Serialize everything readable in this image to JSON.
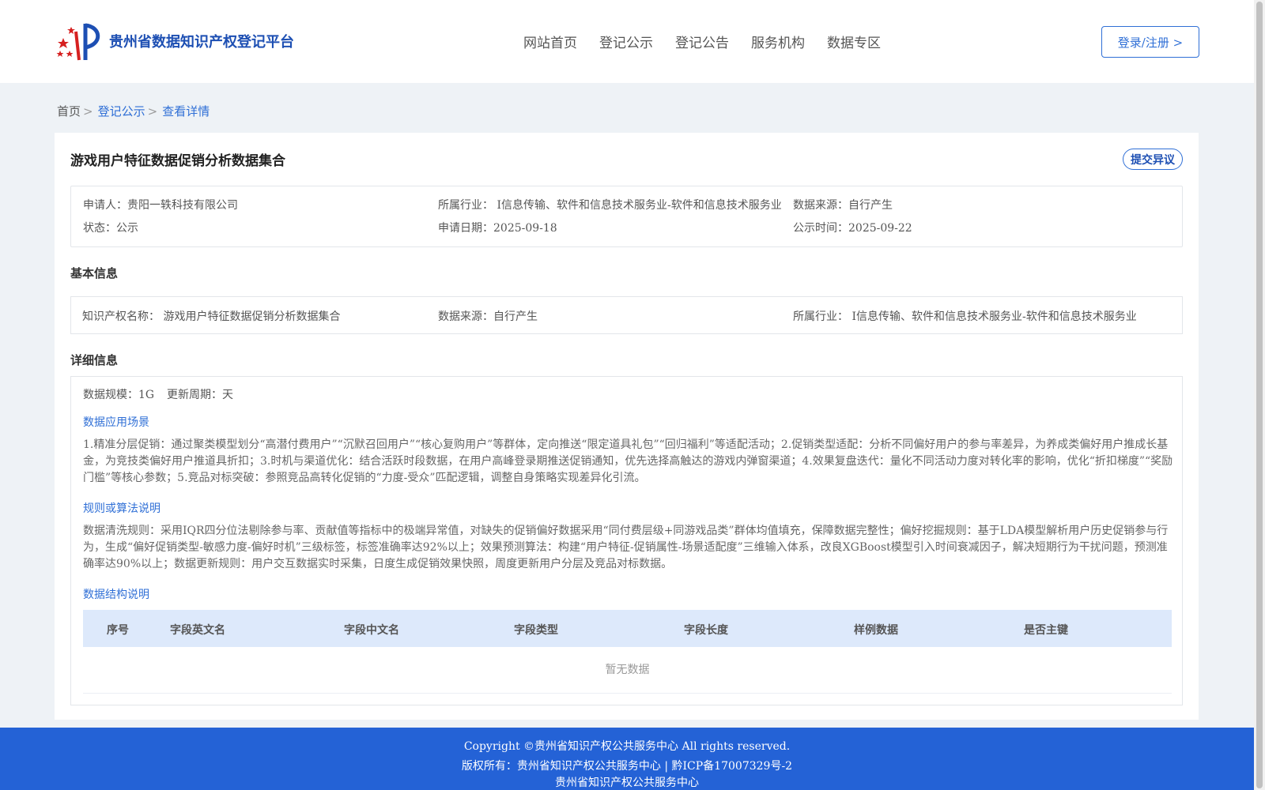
{
  "header": {
    "logo_text": "贵州省数据知识产权登记平台",
    "nav": [
      "网站首页",
      "登记公示",
      "登记公告",
      "服务机构",
      "数据专区"
    ],
    "login_label": "登录/注册 >"
  },
  "breadcrumb": {
    "home": "首页",
    "list": "登记公示",
    "current": "查看详情",
    "separator": ">"
  },
  "detail": {
    "title": "游戏用户特征数据促销分析数据集合",
    "objection_label": "提交异议",
    "meta": {
      "applicant": "申请人：贵阳一轶科技有限公司",
      "industry": "所属行业： I信息传输、软件和信息技术服务业-软件和信息技术服务业",
      "source": "数据来源：自行产生",
      "status": "状态：公示",
      "apply_date": "申请日期：2025-09-18",
      "publish_date": "公示时间：2025-09-22"
    },
    "basic_title": "基本信息",
    "basic": {
      "ip_name": "知识产权名称： 游戏用户特征数据促销分析数据集合",
      "source": "数据来源：自行产生",
      "industry": "所属行业： I信息传输、软件和信息技术服务业-软件和信息技术服务业"
    },
    "detail_title": "详细信息",
    "scale": "数据规模：1G",
    "cycle": "更新周期：天",
    "scenario_title": "数据应用场景",
    "scenario_text": "1.精准分层促销：通过聚类模型划分“高潜付费用户”“沉默召回用户”“核心复购用户”等群体，定向推送“限定道具礼包”“回归福利”等适配活动；2.促销类型适配：分析不同偏好用户的参与率差异，为养成类偏好用户推成长基金，为竞技类偏好用户推道具折扣；3.时机与渠道优化：结合活跃时段数据，在用户高峰登录期推送促销通知，优先选择高触达的游戏内弹窗渠道；4.效果复盘迭代：量化不同活动力度对转化率的影响，优化“折扣梯度”“奖励门槛”等核心参数；5.竞品对标突破：参照竞品高转化促销的“力度-受众”匹配逻辑，调整自身策略实现差异化引流。",
    "rules_title": "规则或算法说明",
    "rules_text": "数据清洗规则：采用IQR四分位法剔除参与率、贡献值等指标中的极端异常值，对缺失的促销偏好数据采用“同付费层级+同游戏品类”群体均值填充，保障数据完整性；偏好挖掘规则：基于LDA模型解析用户历史促销参与行为，生成“偏好促销类型-敏感力度-偏好时机”三级标签，标签准确率达92%以上；效果预测算法：构建“用户特征-促销属性-场景适配度”三维输入体系，改良XGBoost模型引入时间衰减因子，解决短期行为干扰问题，预测准确率达90%以上；数据更新规则：用户交互数据实时采集，日度生成促销效果快照，周度更新用户分层及竞品对标数据。",
    "structure_title": "数据结构说明",
    "table_columns": [
      "序号",
      "字段英文名",
      "字段中文名",
      "字段类型",
      "字段长度",
      "样例数据",
      "是否主键"
    ],
    "empty_text": "暂无数据"
  },
  "footer": {
    "line1": "Copyright ©贵州省知识产权公共服务中心 All rights reserved.",
    "line2": "版权所有：贵州省知识产权公共服务中心 | 黔ICP备17007329号-2",
    "line3": "贵州省知识产权公共服务中心"
  },
  "colors": {
    "brand": "#1d4fb3",
    "link": "#2f6fd6",
    "footer_bg": "#2462d6",
    "page_bg": "#eef2f6",
    "table_head_bg": "#dde9fb"
  }
}
